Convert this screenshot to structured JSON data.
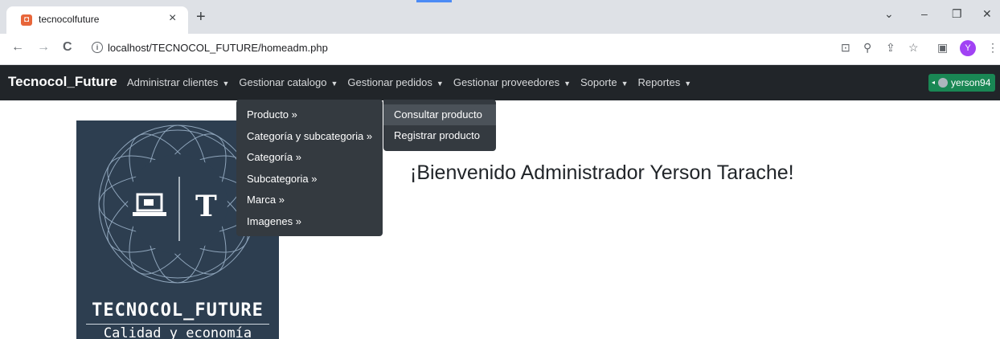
{
  "browser": {
    "tab_title": "tecnocolfuture",
    "tab_close": "×",
    "new_tab": "+",
    "url": "localhost/TECNOCOL_FUTURE/homeadm.php",
    "profile_initial": "Y",
    "window_controls": [
      "⌄",
      "–",
      "❐",
      "✕"
    ],
    "nav": {
      "back": "←",
      "forward": "→",
      "reload": "C"
    }
  },
  "navbar": {
    "brand": "Tecnocol_Future",
    "menu": [
      "Administrar clientes",
      "Gestionar catalogo",
      "Gestionar pedidos",
      "Gestionar proveedores",
      "Soporte",
      "Reportes"
    ],
    "user": "yerson94"
  },
  "dropdown": {
    "items": [
      "Producto »",
      "Categoría y subcategoria »",
      "Categoría »",
      "Subcategoria »",
      "Marca »",
      "Imagenes »"
    ]
  },
  "submenu": {
    "items": [
      "Consultar producto",
      "Registrar producto"
    ],
    "active_index": 0
  },
  "logo": {
    "title": "TECNOCOL_FUTURE",
    "subtitle": "Calidad y economía",
    "letter": "T"
  },
  "main": {
    "welcome": "¡Bienvenido Administrador Yerson Tarache!"
  },
  "colors": {
    "navbar_bg": "#212529",
    "dropdown_bg": "#343a40",
    "user_button": "#198754",
    "logo_bg": "#2d3e50"
  }
}
